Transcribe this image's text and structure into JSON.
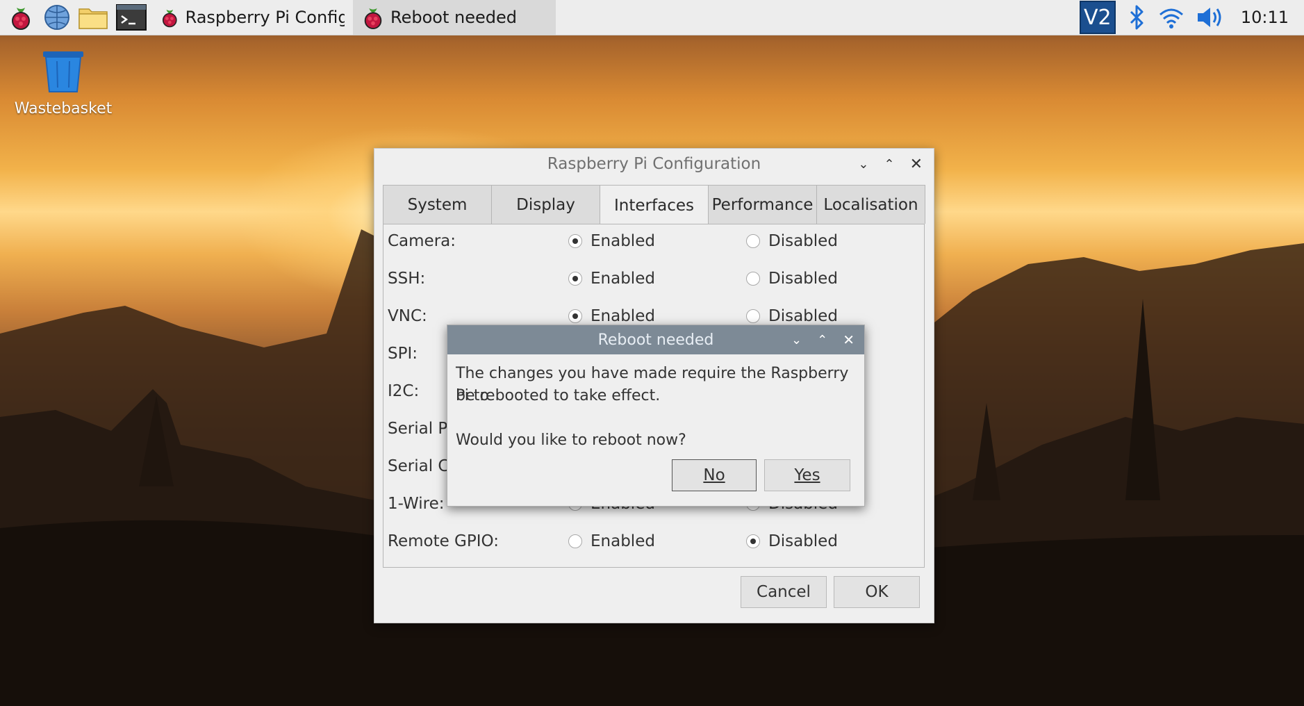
{
  "taskbar": {
    "launchers": [
      "raspberry-menu-icon",
      "web-browser-icon",
      "file-manager-icon",
      "terminal-icon"
    ],
    "tasks": [
      {
        "label": "Raspberry Pi Configu..."
      },
      {
        "label": "Reboot needed"
      }
    ],
    "tray": {
      "vnc_label": "V2",
      "time": "10:11"
    }
  },
  "desktop": {
    "wastebasket_label": "Wastebasket"
  },
  "config_window": {
    "title": "Raspberry Pi Configuration",
    "tabs": [
      {
        "label": "System",
        "active": false
      },
      {
        "label": "Display",
        "active": false
      },
      {
        "label": "Interfaces",
        "active": true
      },
      {
        "label": "Performance",
        "active": false
      },
      {
        "label": "Localisation",
        "active": false
      }
    ],
    "option_enabled": "Enabled",
    "option_disabled": "Disabled",
    "rows": [
      {
        "name": "Camera:",
        "value": "Enabled"
      },
      {
        "name": "SSH:",
        "value": "Enabled"
      },
      {
        "name": "VNC:",
        "value": "Enabled"
      },
      {
        "name": "SPI:",
        "value": ""
      },
      {
        "name": "I2C:",
        "value": ""
      },
      {
        "name": "Serial Pc",
        "value": ""
      },
      {
        "name": "Serial Cc",
        "value": ""
      },
      {
        "name": "1-Wire:",
        "value": "Disabled"
      },
      {
        "name": "Remote GPIO:",
        "value": "Disabled"
      }
    ],
    "cancel_label": "Cancel",
    "ok_label": "OK"
  },
  "reboot_dialog": {
    "title": "Reboot needed",
    "message_line1": "The changes you have made require the Raspberry Pi to",
    "message_line2": "be rebooted to take effect.",
    "question": "Would you like to reboot now?",
    "no_label": "No",
    "yes_label": "Yes"
  },
  "colors": {
    "dialog_titlebar": "#7d8a96",
    "vnc_icon": "#1b4f8f",
    "bluetooth": "#1e6fd6"
  }
}
